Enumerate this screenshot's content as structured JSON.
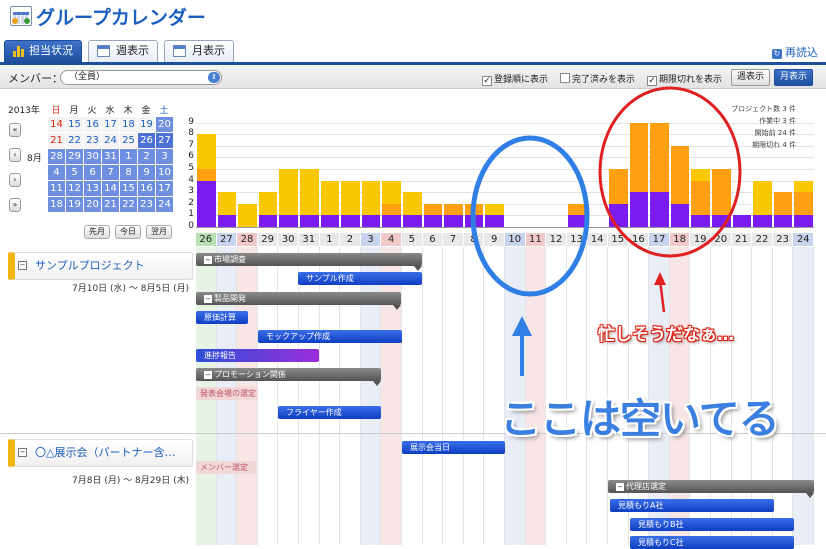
{
  "app": {
    "title": "グループカレンダー",
    "refresh_label": "再読込"
  },
  "tabs": [
    {
      "label": "担当状況",
      "active": true
    },
    {
      "label": "週表示"
    },
    {
      "label": "月表示"
    }
  ],
  "toolbar": {
    "member_label": "メンバー：",
    "member_value": "（全員）",
    "checks": [
      {
        "label": "登録順に表示",
        "checked": true
      },
      {
        "label": "完了済みを表示",
        "checked": false
      },
      {
        "label": "期限切れを表示",
        "checked": true
      }
    ],
    "week_view": "週表示",
    "month_view": "月表示"
  },
  "mini_calendar": {
    "year": "2013年",
    "month": "8月",
    "weekdays": [
      "日",
      "月",
      "火",
      "水",
      "木",
      "金",
      "土"
    ],
    "weeks": [
      [
        "",
        "14",
        "15",
        "16",
        "17",
        "18",
        "19",
        "20"
      ],
      [
        "",
        "21",
        "22",
        "23",
        "24",
        "25",
        "26",
        "27"
      ],
      [
        "8月",
        "28",
        "29",
        "30",
        "31",
        "1",
        "2",
        "3"
      ],
      [
        "",
        "4",
        "5",
        "6",
        "7",
        "8",
        "9",
        "10"
      ],
      [
        "",
        "11",
        "12",
        "13",
        "14",
        "15",
        "16",
        "17"
      ],
      [
        "",
        "18",
        "19",
        "20",
        "21",
        "22",
        "23",
        "24"
      ]
    ],
    "prev": "先月",
    "today": "今日",
    "next": "翌月"
  },
  "stats": {
    "projects": "プロジェクト数 3 件",
    "working": "作業中 3 件",
    "before_start": "開始前 24 件",
    "overdue": "期限切れ 4 件"
  },
  "chart_data": {
    "type": "bar",
    "stacked": true,
    "ylim": [
      0,
      9
    ],
    "yticks": [
      0,
      1,
      2,
      3,
      4,
      5,
      6,
      7,
      8,
      9
    ],
    "categories": [
      "26",
      "27",
      "28",
      "29",
      "30",
      "31",
      "1",
      "2",
      "3",
      "4",
      "5",
      "6",
      "7",
      "8",
      "9",
      "10",
      "11",
      "12",
      "13",
      "14",
      "15",
      "16",
      "17",
      "18",
      "19",
      "20",
      "21",
      "22",
      "23",
      "24"
    ],
    "series": [
      {
        "color": "#7a1cf0",
        "values": [
          4,
          1,
          0,
          1,
          1,
          1,
          1,
          1,
          1,
          1,
          1,
          1,
          1,
          1,
          1,
          0,
          0,
          0,
          1,
          0,
          2,
          3,
          3,
          2,
          1,
          1,
          1,
          1,
          1,
          1
        ]
      },
      {
        "color": "#ffa010",
        "values": [
          1,
          0,
          0,
          0,
          0,
          0,
          0,
          0,
          0,
          1,
          0,
          1,
          1,
          1,
          0,
          0,
          0,
          0,
          1,
          0,
          3,
          6,
          6,
          5,
          3,
          4,
          0,
          0,
          2,
          2
        ]
      },
      {
        "color": "#fac800",
        "values": [
          3,
          2,
          2,
          2,
          4,
          4,
          3,
          3,
          3,
          2,
          2,
          0,
          0,
          0,
          1,
          0,
          0,
          0,
          0,
          0,
          0,
          0,
          0,
          0,
          1,
          0,
          0,
          3,
          0,
          1
        ]
      }
    ]
  },
  "projects": [
    {
      "name": "サンプルプロジェクト",
      "dates": "7月10日 (水) 〜 8月5日 (月)"
    },
    {
      "name": "〇△展示会（パートナー含…",
      "dates": "7月8日 (月) 〜 8月29日 (木)"
    }
  ],
  "tasks": {
    "market_research": "市場調査",
    "sample_making": "サンプル作成",
    "product_dev": "製品開発",
    "cost_calc": "原価計算",
    "mockup": "モックアップ作成",
    "progress_report": "進捗報告",
    "promotion": "プロモーション関係",
    "venue_select": "発表会場の選定",
    "flyer": "フライヤー作成",
    "expo_day": "展示会当日",
    "member_select": "メンバー選定",
    "agency_select": "代理店選定",
    "quote_a": "見積もりA社",
    "quote_b": "見積もりB社",
    "quote_c": "見積もりC社"
  },
  "annotations": {
    "busy": "忙しそうだなぁ…",
    "free": "ここは空いてる"
  }
}
